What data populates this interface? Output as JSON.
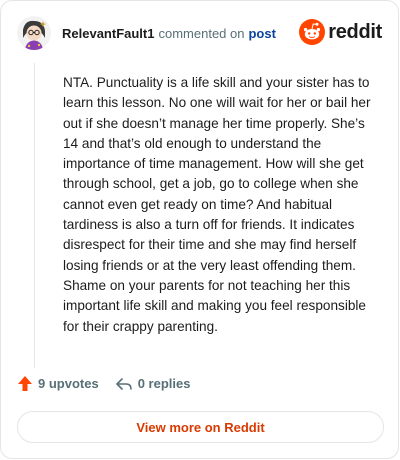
{
  "header": {
    "username": "RelevantFault1",
    "verb": "commented on",
    "post_link": "post",
    "brand_word": "reddit",
    "brand_color": "#ff4500",
    "avatar_icon": "snoo-avatar-icon"
  },
  "comment": {
    "body": "NTA. Punctuality is a life skill and your sister has to learn this lesson. No one will wait for her or bail her out if she doesn’t manage her time properly. She’s 14 and that’s old enough to understand the importance of time management. How will she get through school, get a job, go to college when she cannot even get ready on time? And habitual tardiness is also a turn off for friends. It indicates disrespect for their time and she may find herself losing friends or at the very least offending them. Shame on your parents for not teaching her this important life skill and making you feel responsible for their crappy parenting."
  },
  "actions": {
    "upvotes_label": "9 upvotes",
    "upvote_icon": "upvote-arrow-icon",
    "upvote_color": "#ff4500",
    "replies_label": "0 replies",
    "reply_icon": "reply-arrow-icon"
  },
  "footer": {
    "view_more_label": "View more on Reddit",
    "accent_color": "#d93a00"
  }
}
